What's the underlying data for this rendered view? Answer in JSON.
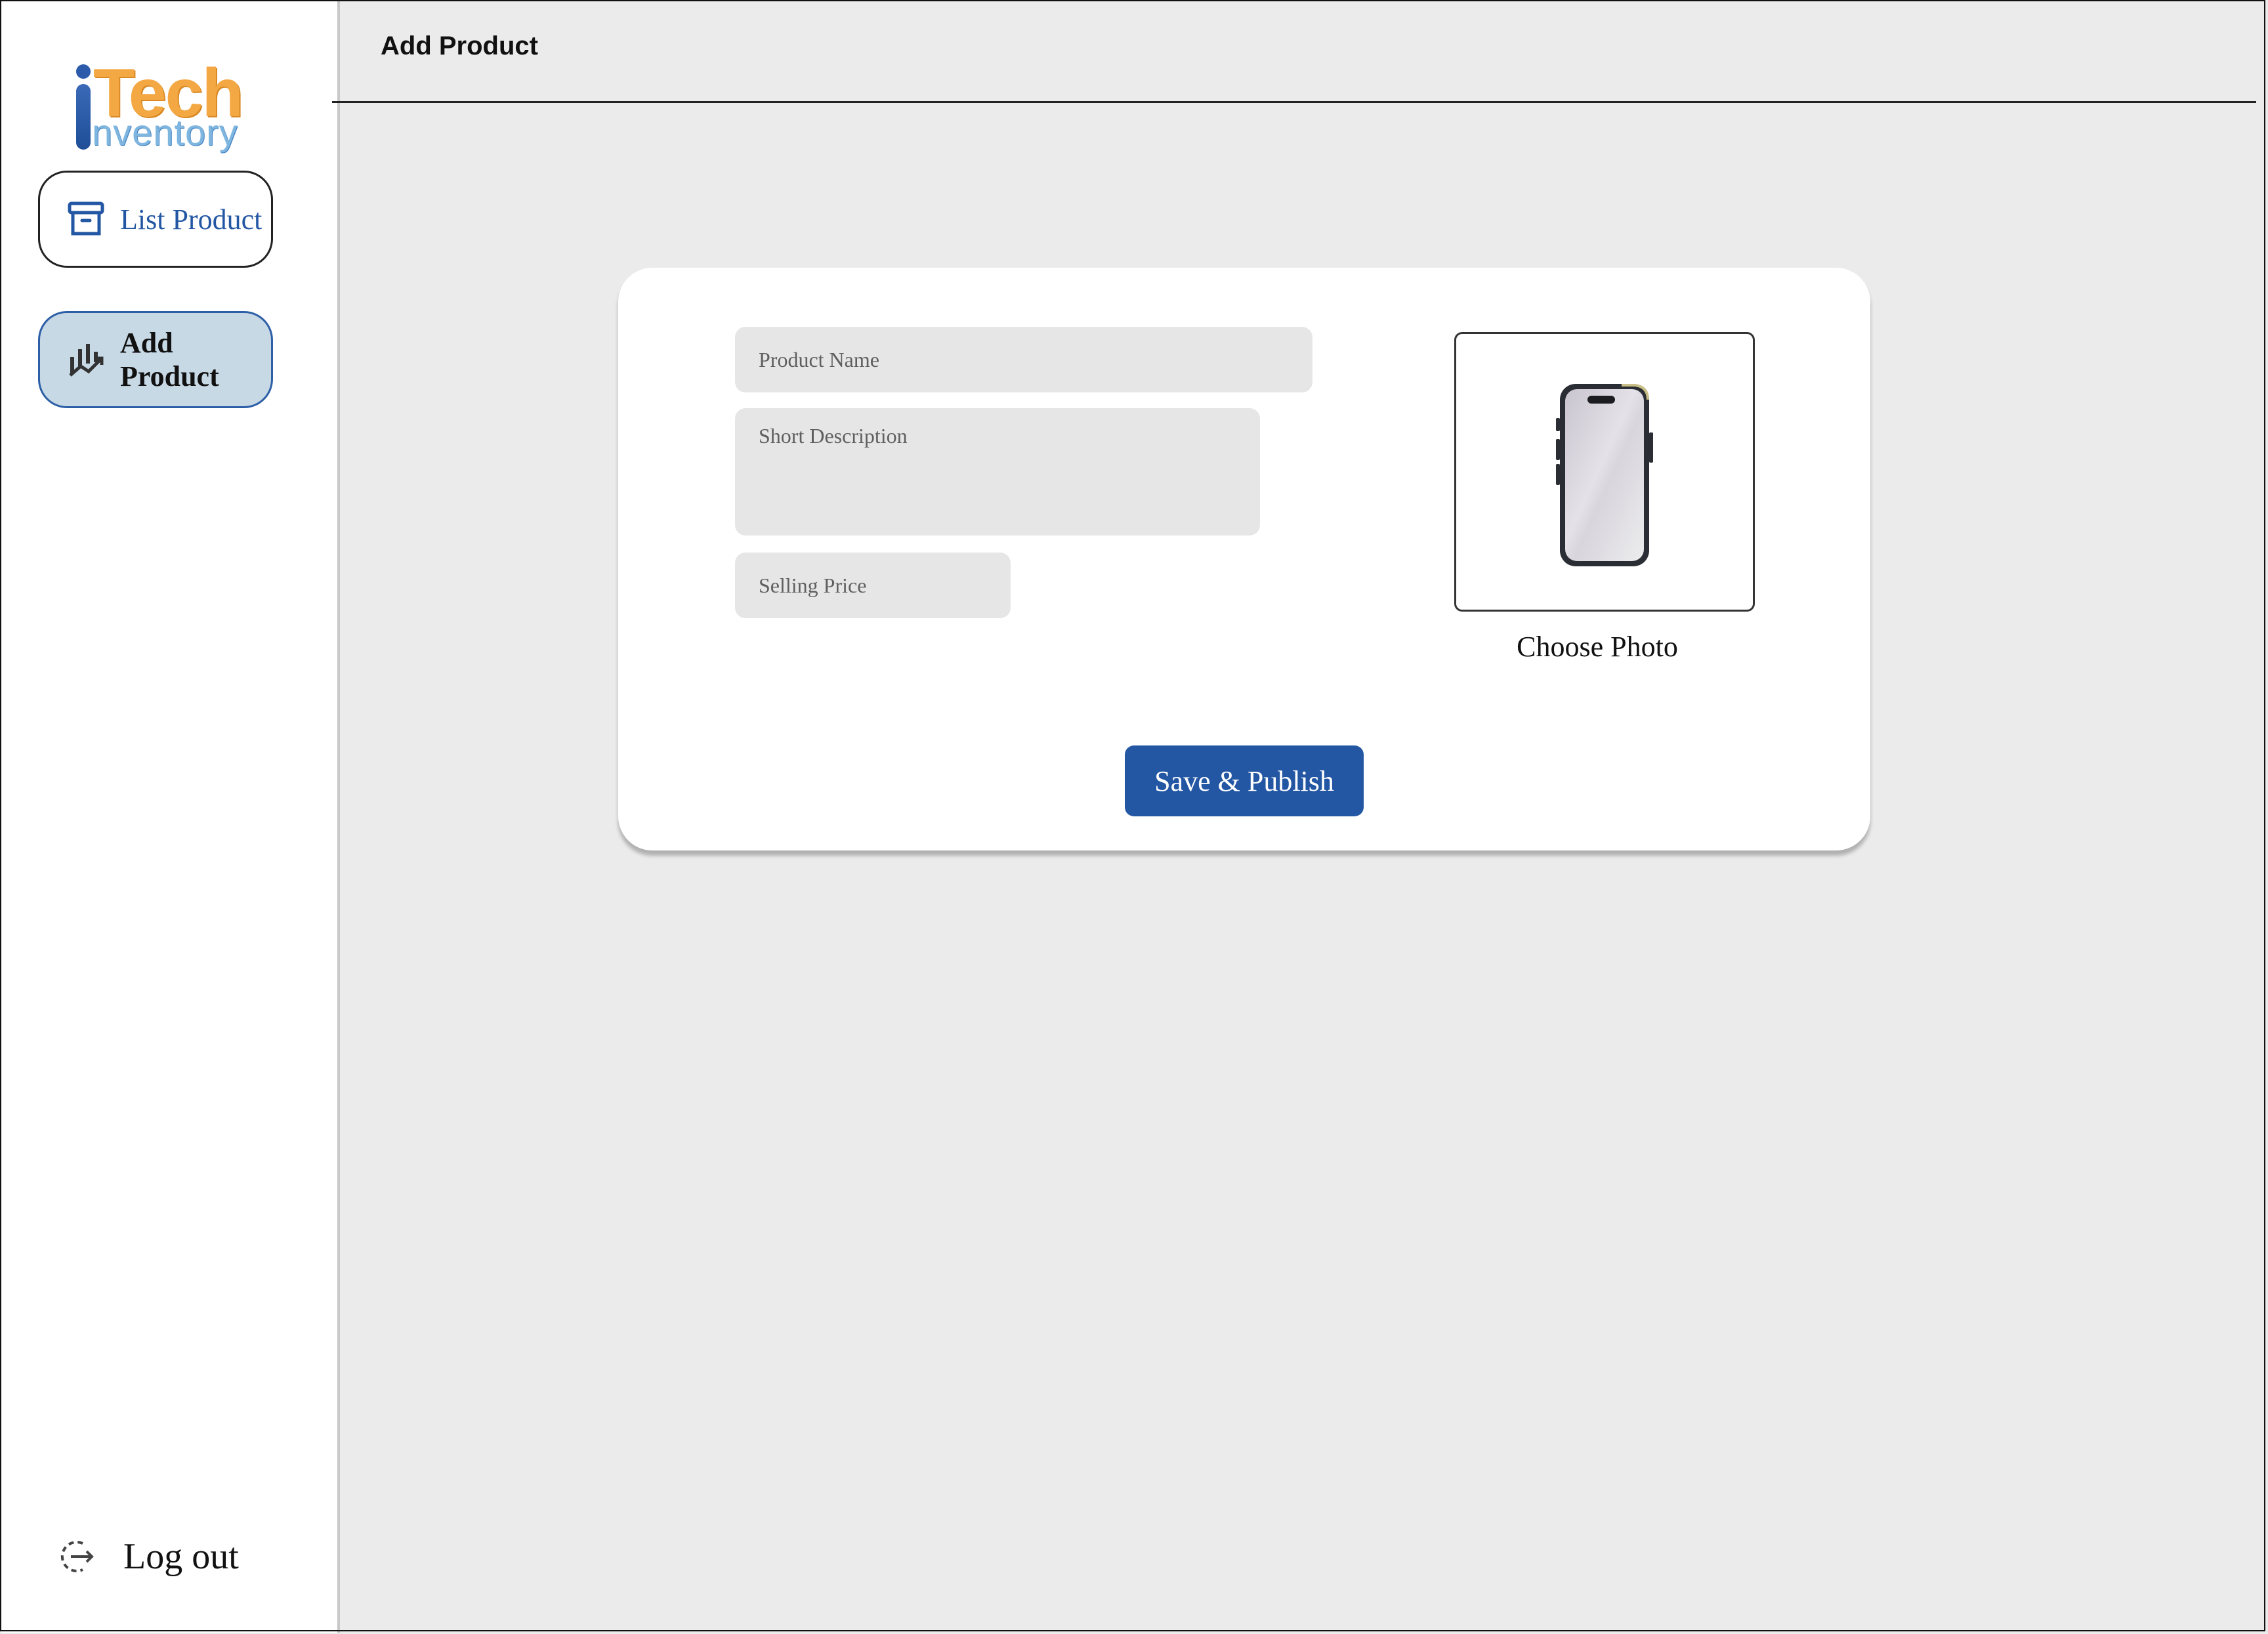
{
  "app": {
    "logo_alt": "iTech Inventory",
    "logo_tech": "Tech",
    "logo_inventory": "nventory"
  },
  "sidebar": {
    "items": [
      {
        "label": "List Product",
        "icon": "archive-box-icon",
        "active": false
      },
      {
        "label": "Add Product",
        "icon": "chart-icon",
        "active": true
      }
    ],
    "logout_label": "Log out"
  },
  "header": {
    "title": "Add Product"
  },
  "form": {
    "product_name": {
      "placeholder": "Product Name",
      "value": ""
    },
    "short_description": {
      "placeholder": "Short Description",
      "value": ""
    },
    "selling_price": {
      "placeholder": "Selling Price",
      "value": ""
    },
    "photo_label": "Choose Photo",
    "save_label": "Save & Publish"
  },
  "colors": {
    "brand_blue": "#2357a3",
    "active_nav_bg": "#c8d9e6",
    "page_bg": "#ebebeb",
    "logo_orange": "#f4a844",
    "logo_light_blue": "#7fb6e0"
  }
}
